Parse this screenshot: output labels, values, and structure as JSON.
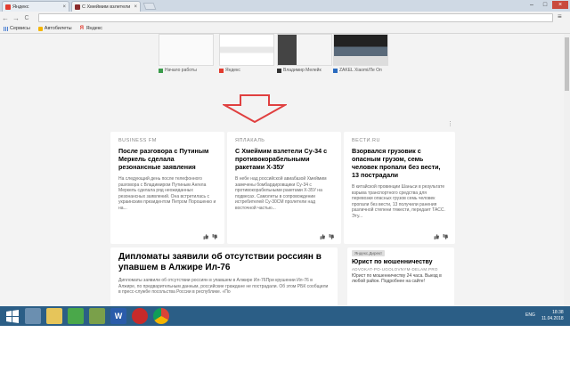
{
  "browser": {
    "tabs": [
      {
        "label": "Яндекс",
        "active": false
      },
      {
        "label": "С Хмеймим взлетели С",
        "active": true
      }
    ],
    "window_controls": {
      "minimize": "–",
      "maximize": "□",
      "close": "×"
    },
    "nav": {
      "back": "←",
      "forward": "→",
      "reload": "C",
      "menu": "≡"
    }
  },
  "bookmarks": [
    {
      "label": "Сервисы",
      "icon": "apps-icon"
    },
    {
      "label": "Автобилеты",
      "icon": "bus-icon"
    },
    {
      "label": "Яндекс",
      "icon": "yandex-icon"
    }
  ],
  "tiles": [
    {
      "caption": "Начало работы",
      "color": "#3a9b4a"
    },
    {
      "caption": "Яндекс",
      "color": "#e23b2e"
    },
    {
      "caption": "Владимир Мелейк",
      "color": "#333333"
    },
    {
      "caption": "ZAKEL Xiaomi/Ле Оп",
      "color": "#2a6bbf"
    }
  ],
  "feed": [
    {
      "source": "BUSINESS FM",
      "title": "После разговора с Путиным Меркель сделала резонансные заявления",
      "body": "На следующий день после телефонного разговора с Владимиром Путиным Ангела Меркель сделала ряд неожиданных резонансных заявлений. Она встретилась с украинским президентом Петром Порошенко и на..."
    },
    {
      "source": "ЯПЛАКАЛЬ",
      "title": "С Хмеймим взлетели Су-34 с противокорабельными ракетами Х-35У",
      "body": "В небе над российской авиабазой Хмеймим замечены бомбардировщики Су-34 с противокорабельными ракетами Х-35У на подвесах. Самолеты в сопровождении истребителей Су-30СМ пролетели над восточной частью..."
    },
    {
      "source": "ВЕСТИ.RU",
      "title": "Взорвался грузовик с опасным грузом, семь человек пропали без вести, 13 пострадали",
      "body": "В китайской провинции Шаньси в результате взрыва транспортного средства для перевозки опасных грузов семь человек пропали без вести, 13 получили ранения различной степени тяжести, передает ТАСС. Эту..."
    }
  ],
  "big_story": {
    "title": "Дипломаты заявили об отсутствии россиян в упавшем в Алжире Ил-76",
    "body": "Дипломаты заявили об отсутствии россиян в упавшем в Алжире Ил-76При крушении Ил-76 в Алжире, по предварительным данным, российские граждане не пострадали. Об этом РБК сообщили в пресс-службе посольства России в республике. «По"
  },
  "ad": {
    "badge": "Яндекс.Директ",
    "title": "Юрист по мошенничеству",
    "url": "ADVOKAT-PO-UGOLOVNYM-DELAM.PRO",
    "body": "Юрист по мошенничеству 24 часа. Выезд в любой район. Подробнее на сайте!"
  },
  "taskbar": {
    "lang": "ENG",
    "time": "18:38",
    "date": "11.04.2018"
  },
  "colors": {
    "arrow": "#e04040",
    "taskbar": "#2b5e86",
    "tab_strip": "#cfd9e4"
  }
}
